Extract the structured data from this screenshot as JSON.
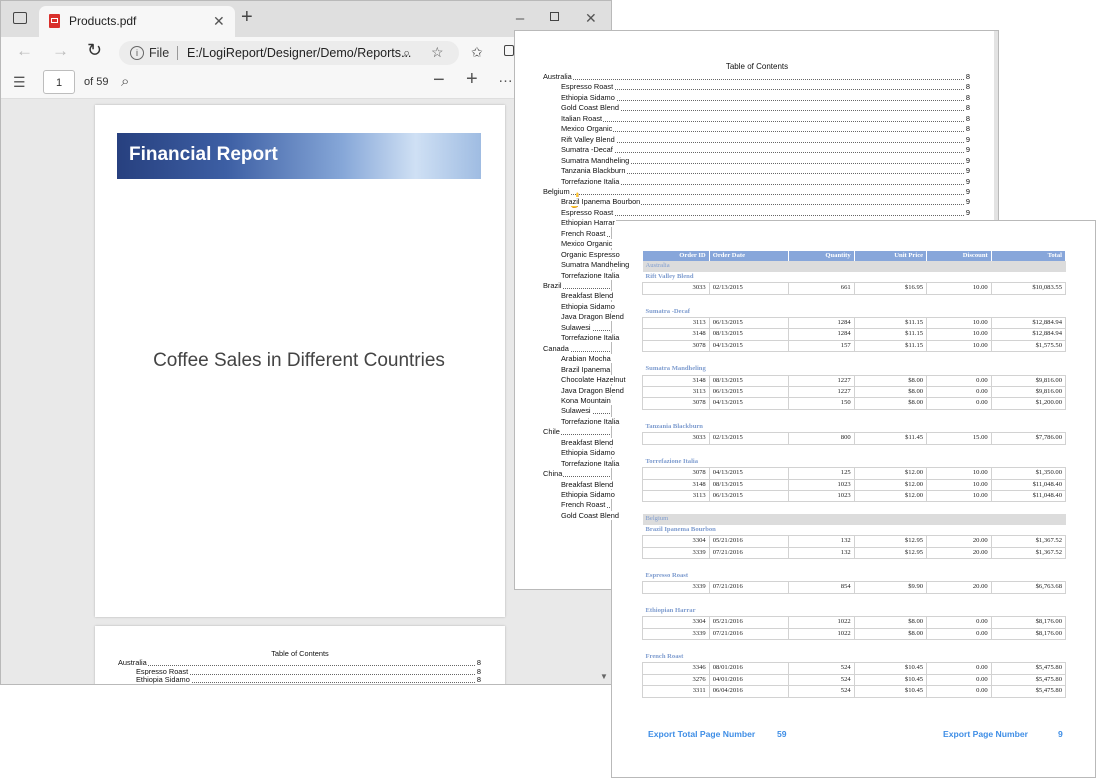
{
  "browser": {
    "tab_title": "Products.pdf",
    "address_label": "File",
    "url": "E:/LogiReport/Designer/Demo/Reports...",
    "current_page": "1",
    "page_total": "of 59"
  },
  "cover": {
    "banner_title": "Financial Report",
    "subtitle": "Coffee Sales in Different Countries"
  },
  "toc": {
    "title": "Table of Contents",
    "entries": [
      {
        "label": "Australia",
        "page": "8",
        "indent": 0
      },
      {
        "label": "Espresso Roast",
        "page": "8",
        "indent": 1
      },
      {
        "label": "Ethiopia Sidamo",
        "page": "8",
        "indent": 1
      },
      {
        "label": "Gold Coast Blend",
        "page": "8",
        "indent": 1
      },
      {
        "label": "Italian Roast",
        "page": "8",
        "indent": 1
      },
      {
        "label": "Mexico Organic",
        "page": "8",
        "indent": 1
      },
      {
        "label": "Rift Valley Blend",
        "page": "9",
        "indent": 1
      },
      {
        "label": "Sumatra -Decaf",
        "page": "9",
        "indent": 1
      },
      {
        "label": "Sumatra Mandheling",
        "page": "9",
        "indent": 1
      },
      {
        "label": "Tanzania Blackburn",
        "page": "9",
        "indent": 1
      },
      {
        "label": "Torrefazione Italia",
        "page": "9",
        "indent": 1
      },
      {
        "label": "Belgium",
        "page": "9",
        "indent": 0
      },
      {
        "label": "Brazil Ipanema Bourbon",
        "page": "9",
        "indent": 1
      },
      {
        "label": "Espresso Roast",
        "page": "9",
        "indent": 1
      },
      {
        "label": "Ethiopian Harrar",
        "page": "",
        "indent": 1
      },
      {
        "label": "French Roast",
        "page": "",
        "indent": 1
      },
      {
        "label": "Mexico Organic",
        "page": "",
        "indent": 1
      },
      {
        "label": "Organic Espresso",
        "page": "",
        "indent": 1
      },
      {
        "label": "Sumatra Mandheling",
        "page": "",
        "indent": 1
      },
      {
        "label": "Torrefazione Italia",
        "page": "",
        "indent": 1
      },
      {
        "label": "Brazil",
        "page": "",
        "indent": 0
      },
      {
        "label": "Breakfast Blend",
        "page": "",
        "indent": 1
      },
      {
        "label": "Ethiopia Sidamo",
        "page": "",
        "indent": 1
      },
      {
        "label": "Java Dragon Blend",
        "page": "",
        "indent": 1
      },
      {
        "label": "Sulawesi",
        "page": "",
        "indent": 1
      },
      {
        "label": "Torrefazione Italia",
        "page": "",
        "indent": 1
      },
      {
        "label": "Canada",
        "page": "",
        "indent": 0
      },
      {
        "label": "Arabian Mocha",
        "page": "",
        "indent": 1
      },
      {
        "label": "Brazil Ipanema",
        "page": "",
        "indent": 1
      },
      {
        "label": "Chocolate Hazelnut",
        "page": "",
        "indent": 1
      },
      {
        "label": "Java Dragon Blend",
        "page": "",
        "indent": 1
      },
      {
        "label": "Kona Mountain",
        "page": "",
        "indent": 1
      },
      {
        "label": "Sulawesi",
        "page": "",
        "indent": 1
      },
      {
        "label": "Torrefazione Italia",
        "page": "",
        "indent": 1
      },
      {
        "label": "Chile",
        "page": "",
        "indent": 0
      },
      {
        "label": "Breakfast Blend",
        "page": "",
        "indent": 1
      },
      {
        "label": "Ethiopia Sidamo",
        "page": "",
        "indent": 1
      },
      {
        "label": "Torrefazione Italia",
        "page": "",
        "indent": 1
      },
      {
        "label": "China",
        "page": "",
        "indent": 0
      },
      {
        "label": "Breakfast Blend",
        "page": "",
        "indent": 1
      },
      {
        "label": "Ethiopia Sidamo",
        "page": "",
        "indent": 1
      },
      {
        "label": "French Roast",
        "page": "",
        "indent": 1
      },
      {
        "label": "Gold Coast Blend",
        "page": "",
        "indent": 1
      }
    ],
    "preview_entries": [
      {
        "label": "Australia",
        "page": "8",
        "indent": 0
      },
      {
        "label": "Espresso Roast",
        "page": "8",
        "indent": 1
      },
      {
        "label": "Ethiopia Sidamo",
        "page": "8",
        "indent": 1
      }
    ]
  },
  "detail": {
    "columns": [
      "Order ID",
      "Order Date",
      "Quantity",
      "Unit Price",
      "Discount",
      "Total"
    ],
    "rows": [
      {
        "kind": "country",
        "text": "Australia"
      },
      {
        "kind": "product",
        "text": "Rift Valley Blend"
      },
      {
        "kind": "data",
        "cells": [
          "3033",
          "02/13/2015",
          "661",
          "$16.95",
          "10.00",
          "$10,083.55"
        ]
      },
      {
        "kind": "gap"
      },
      {
        "kind": "product",
        "text": "Sumatra -Decaf"
      },
      {
        "kind": "data",
        "cells": [
          "3113",
          "06/13/2015",
          "1284",
          "$11.15",
          "10.00",
          "$12,884.94"
        ]
      },
      {
        "kind": "data",
        "cells": [
          "3148",
          "08/13/2015",
          "1284",
          "$11.15",
          "10.00",
          "$12,884.94"
        ]
      },
      {
        "kind": "data",
        "cells": [
          "3078",
          "04/13/2015",
          "157",
          "$11.15",
          "10.00",
          "$1,575.50"
        ]
      },
      {
        "kind": "gap"
      },
      {
        "kind": "product",
        "text": "Sumatra Mandheling"
      },
      {
        "kind": "data",
        "cells": [
          "3148",
          "08/13/2015",
          "1227",
          "$8.00",
          "0.00",
          "$9,816.00"
        ]
      },
      {
        "kind": "data",
        "cells": [
          "3113",
          "06/13/2015",
          "1227",
          "$8.00",
          "0.00",
          "$9,816.00"
        ]
      },
      {
        "kind": "data",
        "cells": [
          "3078",
          "04/13/2015",
          "150",
          "$8.00",
          "0.00",
          "$1,200.00"
        ]
      },
      {
        "kind": "gap"
      },
      {
        "kind": "product",
        "text": "Tanzania Blackburn"
      },
      {
        "kind": "data",
        "cells": [
          "3033",
          "02/13/2015",
          "800",
          "$11.45",
          "15.00",
          "$7,786.00"
        ]
      },
      {
        "kind": "gap"
      },
      {
        "kind": "product",
        "text": "Torrefazione Italia"
      },
      {
        "kind": "data",
        "cells": [
          "3078",
          "04/13/2015",
          "125",
          "$12.00",
          "10.00",
          "$1,350.00"
        ]
      },
      {
        "kind": "data",
        "cells": [
          "3148",
          "08/13/2015",
          "1023",
          "$12.00",
          "10.00",
          "$11,048.40"
        ]
      },
      {
        "kind": "data",
        "cells": [
          "3113",
          "06/13/2015",
          "1023",
          "$12.00",
          "10.00",
          "$11,048.40"
        ]
      },
      {
        "kind": "gap"
      },
      {
        "kind": "country",
        "text": "Belgium"
      },
      {
        "kind": "product",
        "text": "Brazil Ipanema Bourbon"
      },
      {
        "kind": "data",
        "cells": [
          "3304",
          "05/21/2016",
          "132",
          "$12.95",
          "20.00",
          "$1,367.52"
        ]
      },
      {
        "kind": "data",
        "cells": [
          "3339",
          "07/21/2016",
          "132",
          "$12.95",
          "20.00",
          "$1,367.52"
        ]
      },
      {
        "kind": "gap"
      },
      {
        "kind": "product",
        "text": "Espresso Roast"
      },
      {
        "kind": "data",
        "cells": [
          "3339",
          "07/21/2016",
          "854",
          "$9.90",
          "20.00",
          "$6,763.68"
        ]
      },
      {
        "kind": "gap"
      },
      {
        "kind": "product",
        "text": "Ethiopian Harrar"
      },
      {
        "kind": "data",
        "cells": [
          "3304",
          "05/21/2016",
          "1022",
          "$8.00",
          "0.00",
          "$8,176.00"
        ]
      },
      {
        "kind": "data",
        "cells": [
          "3339",
          "07/21/2016",
          "1022",
          "$8.00",
          "0.00",
          "$8,176.00"
        ]
      },
      {
        "kind": "gap"
      },
      {
        "kind": "product",
        "text": "French Roast"
      },
      {
        "kind": "data",
        "cells": [
          "3346",
          "08/01/2016",
          "524",
          "$10.45",
          "0.00",
          "$5,475.80"
        ]
      },
      {
        "kind": "data",
        "cells": [
          "3276",
          "04/01/2016",
          "524",
          "$10.45",
          "0.00",
          "$5,475.80"
        ]
      },
      {
        "kind": "data",
        "cells": [
          "3311",
          "06/04/2016",
          "524",
          "$10.45",
          "0.00",
          "$5,475.80"
        ]
      }
    ],
    "footer_total_label": "Export Total Page Number",
    "footer_total_value": "59",
    "footer_page_label": "Export Page Number",
    "footer_page_value": "9"
  }
}
